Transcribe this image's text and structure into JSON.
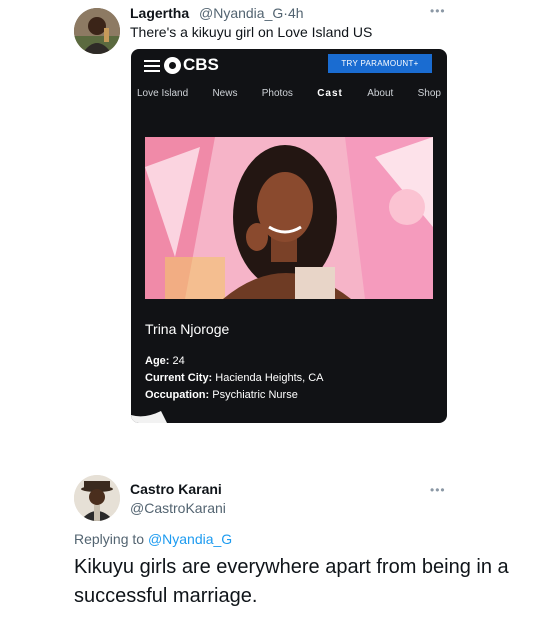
{
  "tweet1": {
    "author_name": "Lagertha",
    "author_handle": "@Nyandia_G",
    "separator": "·",
    "time": "4h",
    "text": "There's a kikuyu girl on Love Island US",
    "more_icon": "more-horizontal-icon"
  },
  "cbs": {
    "logo_text": "CBS",
    "try_button": "TRY PARAMOUNT+",
    "nav": [
      "Love Island",
      "News",
      "Photos",
      "Cast",
      "About",
      "Shop"
    ],
    "active_nav": "Cast",
    "photo_icon": "contestant-photo",
    "contestant_name": "Trina Njoroge",
    "age_label": "Age:",
    "age_value": "24",
    "city_label": "Current City:",
    "city_value": "Hacienda Heights, CA",
    "occupation_label": "Occupation:",
    "occupation_value": "Psychiatric Nurse",
    "accent_color": "#1a6cd1"
  },
  "tweet2": {
    "author_name": "Castro Karani",
    "author_handle": "@CastroKarani",
    "reply_prefix": "Replying to",
    "reply_to": "@Nyandia_G",
    "text": "Kikuyu girls are everywhere apart from being in a successful marriage.",
    "more_icon": "more-horizontal-icon"
  },
  "colors": {
    "mention": "#1d9bf0",
    "secondary_text": "#536471"
  }
}
